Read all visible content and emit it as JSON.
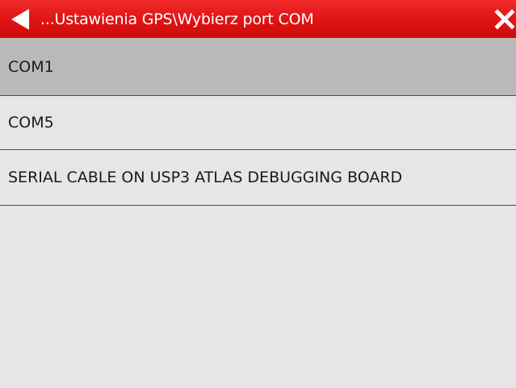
{
  "header": {
    "title": "...Ustawienia GPS\\Wybierz port COM",
    "back_icon": "back-arrow-icon",
    "close_icon": "close-x-icon"
  },
  "ports": {
    "items": [
      {
        "label": "COM1",
        "selected": true
      },
      {
        "label": "COM5",
        "selected": false
      },
      {
        "label": "SERIAL CABLE ON USP3 ATLAS DEBUGGING BOARD",
        "selected": false
      }
    ]
  },
  "colors": {
    "header_bg": "#e11515",
    "selected_bg": "#b9b9b9",
    "list_bg": "#e6e6e6",
    "divider": "#4d4d4d"
  }
}
